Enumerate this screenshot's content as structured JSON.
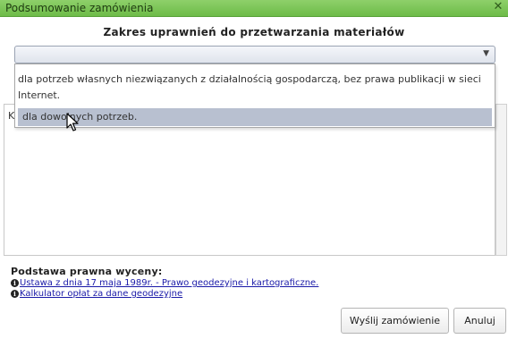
{
  "window": {
    "title": "Podsumowanie zamówienia"
  },
  "permissions": {
    "heading": "Zakres uprawnień do przetwarzania materiałów",
    "selected_value": "",
    "options": [
      "dla potrzeb własnych niezwiązanych z działalnością gospodarczą, bez prawa publikacji w sieci Internet.",
      "dla dowolnych potrzeb."
    ],
    "highlighted_index": 1
  },
  "notes": {
    "visible_text": "K"
  },
  "legal": {
    "heading": "Podstawa prawna wyceny:",
    "links": [
      "Ustawa z dnia 17 maja 1989r. - Prawo geodezyjne i kartograficzne.",
      "Kalkulator opłat za dane geodezyjne"
    ]
  },
  "buttons": {
    "send": "Wyślij zamówienie",
    "cancel": "Anuluj"
  },
  "icons": {
    "close": "close-icon",
    "dropdown_arrow": "chevron-down-icon",
    "info": "info-icon",
    "cursor": "mouse-pointer-icon"
  },
  "colors": {
    "titlebar": "#7cc656",
    "highlight": "#b8c0d0",
    "link": "#1a1aa8"
  }
}
